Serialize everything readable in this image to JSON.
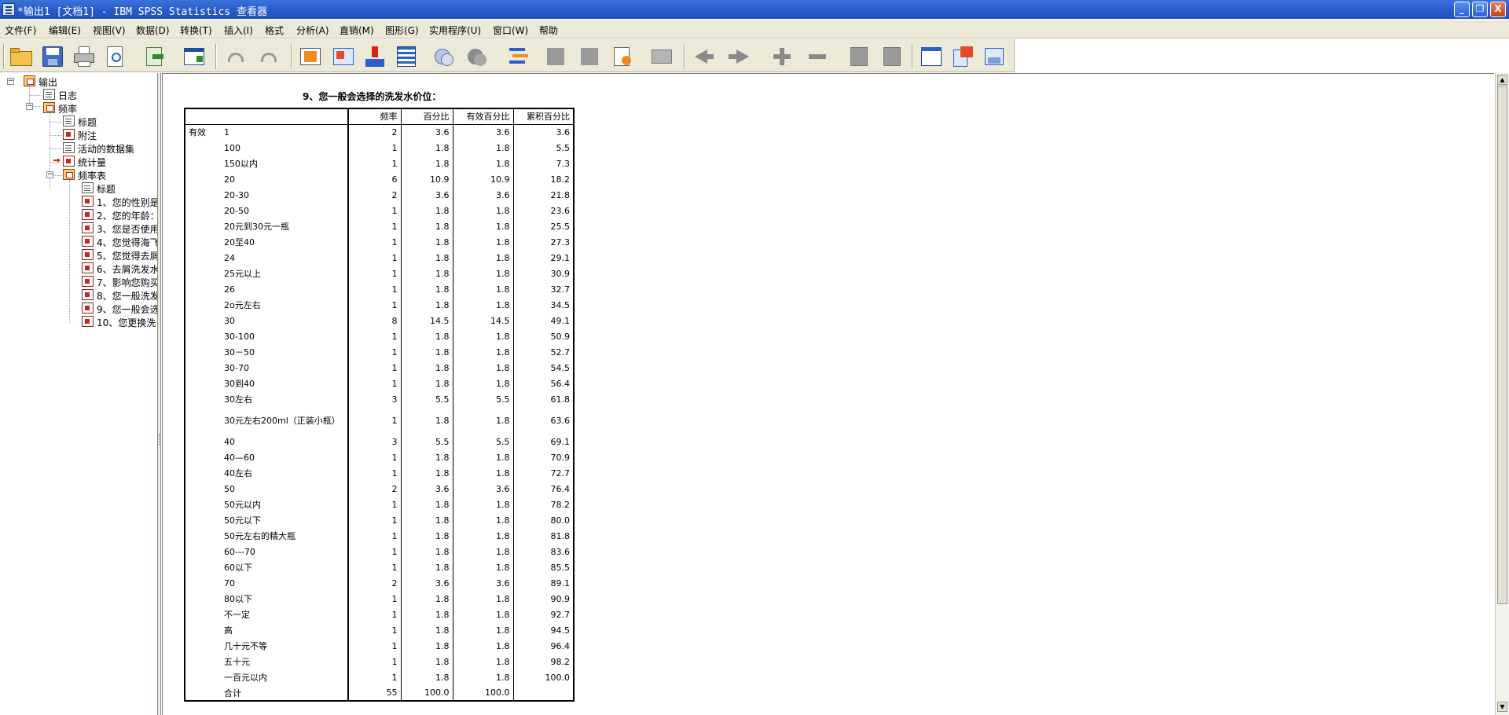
{
  "window": {
    "title": "*输出1 [文档1] - IBM SPSS Statistics 查看器",
    "min_label": "_",
    "max_label": "❐",
    "close_label": "X"
  },
  "menu": [
    "文件(F)",
    "编辑(E)",
    "视图(V)",
    "数据(D)",
    "转换(T)",
    "插入(I)",
    "格式",
    "分析(A)",
    "直销(M)",
    "图形(G)",
    "实用程序(U)",
    "窗口(W)",
    "帮助"
  ],
  "toolbar_icons": [
    "open-folder-icon",
    "save-icon",
    "print-icon",
    "print-preview-icon",
    "export-icon",
    "dialog-recall-icon",
    "undo-icon",
    "redo-icon",
    "goto-data-icon",
    "goto-case-icon",
    "goto-variable-icon",
    "variables-icon",
    "show-all-icon",
    "hide-icon",
    "designate-window-icon",
    "insert-heading-icon",
    "insert-title-icon",
    "insert-text-icon",
    "insert-image-icon",
    "insert-chart-icon",
    "back-icon",
    "forward-icon",
    "expand-icon",
    "collapse-icon",
    "show-icon",
    "hide-output-icon",
    "spreadsheet-icon",
    "word-export-icon",
    "pdf-export-icon"
  ],
  "tree": {
    "root": "输出",
    "log": "日志",
    "frequencies": "频率",
    "items": [
      "标题",
      "附注",
      "活动的数据集",
      "统计量"
    ],
    "freq_table": "频率表",
    "freq_items": [
      "标题",
      "1、您的性别是",
      "2、您的年龄：",
      "3、您是否使用",
      "4、您觉得海飞",
      "5、您觉得去屑",
      "6、去屑洗发水",
      "7、影响您购买",
      "8、您一般洗发",
      "9、您一般会选",
      "10、您更换洗"
    ]
  },
  "table": {
    "title": "9、您一般会选择的洗发水价位：",
    "headers": [
      "",
      "",
      "频率",
      "百分比",
      "有效百分比",
      "累积百分比"
    ],
    "group_label": "有效",
    "rows": [
      [
        "1",
        "2",
        "3.6",
        "3.6",
        "3.6"
      ],
      [
        "100",
        "1",
        "1.8",
        "1.8",
        "5.5"
      ],
      [
        "150以内",
        "1",
        "1.8",
        "1.8",
        "7.3"
      ],
      [
        "20",
        "6",
        "10.9",
        "10.9",
        "18.2"
      ],
      [
        "20-30",
        "2",
        "3.6",
        "3.6",
        "21.8"
      ],
      [
        "20-50",
        "1",
        "1.8",
        "1.8",
        "23.6"
      ],
      [
        "20元到30元一瓶",
        "1",
        "1.8",
        "1.8",
        "25.5"
      ],
      [
        "20至40",
        "1",
        "1.8",
        "1.8",
        "27.3"
      ],
      [
        "24",
        "1",
        "1.8",
        "1.8",
        "29.1"
      ],
      [
        "25元以上",
        "1",
        "1.8",
        "1.8",
        "30.9"
      ],
      [
        "26",
        "1",
        "1.8",
        "1.8",
        "32.7"
      ],
      [
        "2o元左右",
        "1",
        "1.8",
        "1.8",
        "34.5"
      ],
      [
        "30",
        "8",
        "14.5",
        "14.5",
        "49.1"
      ],
      [
        "30-100",
        "1",
        "1.8",
        "1.8",
        "50.9"
      ],
      [
        "30－50",
        "1",
        "1.8",
        "1.8",
        "52.7"
      ],
      [
        "30-70",
        "1",
        "1.8",
        "1.8",
        "54.5"
      ],
      [
        "30到40",
        "1",
        "1.8",
        "1.8",
        "56.4"
      ],
      [
        "30左右",
        "3",
        "5.5",
        "5.5",
        "61.8"
      ],
      [
        "30元左右200ml（正装小瓶）",
        "1",
        "1.8",
        "1.8",
        "63.6"
      ],
      [
        "40",
        "3",
        "5.5",
        "5.5",
        "69.1"
      ],
      [
        "40—60",
        "1",
        "1.8",
        "1.8",
        "70.9"
      ],
      [
        "40左右",
        "1",
        "1.8",
        "1.8",
        "72.7"
      ],
      [
        "50",
        "2",
        "3.6",
        "3.6",
        "76.4"
      ],
      [
        "50元以内",
        "1",
        "1.8",
        "1.8",
        "78.2"
      ],
      [
        "50元以下",
        "1",
        "1.8",
        "1.8",
        "80.0"
      ],
      [
        "50元左右的精大瓶",
        "1",
        "1.8",
        "1.8",
        "81.8"
      ],
      [
        "60---70",
        "1",
        "1.8",
        "1.8",
        "83.6"
      ],
      [
        "60以下",
        "1",
        "1.8",
        "1.8",
        "85.5"
      ],
      [
        "70",
        "2",
        "3.6",
        "3.6",
        "89.1"
      ],
      [
        "80以下",
        "1",
        "1.8",
        "1.8",
        "90.9"
      ],
      [
        "不一定",
        "1",
        "1.8",
        "1.8",
        "92.7"
      ],
      [
        "高",
        "1",
        "1.8",
        "1.8",
        "94.5"
      ],
      [
        "几十元不等",
        "1",
        "1.8",
        "1.8",
        "96.4"
      ],
      [
        "五十元",
        "1",
        "1.8",
        "1.8",
        "98.2"
      ],
      [
        "一百元以内",
        "1",
        "1.8",
        "1.8",
        "100.0"
      ],
      [
        "合计",
        "55",
        "100.0",
        "100.0",
        ""
      ]
    ]
  },
  "scrollbar": {
    "up": "▲",
    "down": "▼"
  },
  "colors": {
    "titlebar": "#2a5fcc",
    "chrome": "#ece9d8"
  }
}
